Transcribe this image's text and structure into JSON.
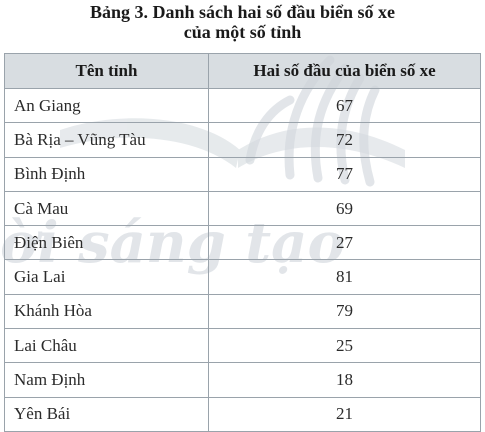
{
  "title": {
    "line1": "Bảng 3. Danh sách hai số đầu biển số xe",
    "line2": "của một số tỉnh"
  },
  "table": {
    "headers": [
      "Tên tỉnh",
      "Hai số đầu của biển số xe"
    ],
    "rows": [
      {
        "name": "An Giang",
        "value": "67"
      },
      {
        "name": "Bà Rịa – Vũng Tàu",
        "value": "72"
      },
      {
        "name": "Bình Định",
        "value": "77"
      },
      {
        "name": "Cà Mau",
        "value": "69"
      },
      {
        "name": "Điện Biên",
        "value": "27"
      },
      {
        "name": "Gia Lai",
        "value": "81"
      },
      {
        "name": "Khánh Hòa",
        "value": "79"
      },
      {
        "name": "Lai Châu",
        "value": "25"
      },
      {
        "name": "Nam Định",
        "value": "18"
      },
      {
        "name": "Yên Bái",
        "value": "21"
      }
    ]
  },
  "watermark": {
    "text": "Chân trời sáng tạo",
    "color": "#c8ced4"
  }
}
